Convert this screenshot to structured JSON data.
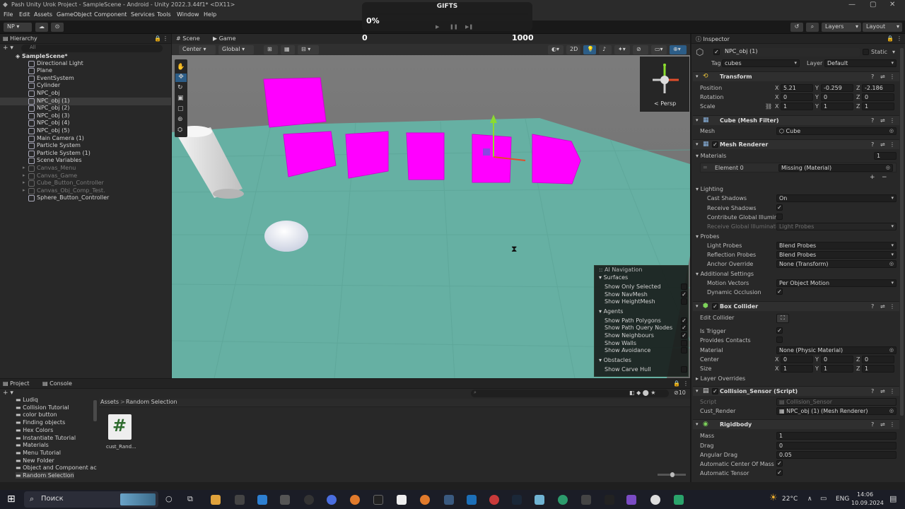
{
  "window": {
    "title": "Pash Unity Urok Project - SampleScene - Android - Unity 2022.3.44f1* <DX11>",
    "menu": [
      "File",
      "Edit",
      "Assets",
      "GameObject",
      "Component",
      "Services",
      "Tools",
      "Window",
      "Help"
    ]
  },
  "toolbar": {
    "account": "NP",
    "layers": "Layers",
    "layout": "Layout"
  },
  "gifts": {
    "label": "GIFTS",
    "percent": "0%",
    "left_num": "0",
    "right_num": "1000",
    "progress_fraction": 0.0
  },
  "hierarchy": {
    "tab": "Hierarchy",
    "search_placeholder": "All",
    "scene": "SampleScene*",
    "items": [
      {
        "label": "Directional Light",
        "gray": false
      },
      {
        "label": "Plane",
        "gray": false
      },
      {
        "label": "EventSystem",
        "gray": false
      },
      {
        "label": "Cylinder",
        "gray": false
      },
      {
        "label": "NPC_obj",
        "gray": false
      },
      {
        "label": "NPC_obj (1)",
        "gray": false,
        "selected": true
      },
      {
        "label": "NPC_obj (2)",
        "gray": false
      },
      {
        "label": "NPC_obj (3)",
        "gray": false
      },
      {
        "label": "NPC_obj (4)",
        "gray": false
      },
      {
        "label": "NPC_obj (5)",
        "gray": false
      },
      {
        "label": "Main Camera (1)",
        "gray": false
      },
      {
        "label": "Particle System",
        "gray": false
      },
      {
        "label": "Particle System (1)",
        "gray": false
      },
      {
        "label": "Scene Variables",
        "gray": false
      },
      {
        "label": "Canvas_Menu",
        "gray": true
      },
      {
        "label": "Canvas_Game",
        "gray": true
      },
      {
        "label": "Cube_Button_Controller",
        "gray": true
      },
      {
        "label": "Canvas_Obj_Comp_Test.",
        "gray": true
      },
      {
        "label": "Sphere_Button_Controller",
        "gray": false
      }
    ]
  },
  "scene_view": {
    "tabs": [
      "Scene",
      "Game"
    ],
    "pivot": "Center",
    "space": "Global",
    "mode_2d": "2D",
    "persp": "Persp"
  },
  "ai_navigation": {
    "title": "AI Navigation",
    "sections": [
      {
        "name": "Surfaces",
        "items": [
          {
            "label": "Show Only Selected",
            "checked": false
          },
          {
            "label": "Show NavMesh",
            "checked": true
          },
          {
            "label": "Show HeightMesh",
            "checked": false
          }
        ]
      },
      {
        "name": "Agents",
        "items": [
          {
            "label": "Show Path Polygons",
            "checked": true
          },
          {
            "label": "Show Path Query Nodes",
            "checked": true
          },
          {
            "label": "Show Neighbours",
            "checked": true
          },
          {
            "label": "Show Walls",
            "checked": false
          },
          {
            "label": "Show Avoidance",
            "checked": false
          }
        ]
      },
      {
        "name": "Obstacles",
        "items": [
          {
            "label": "Show Carve Hull",
            "checked": false
          }
        ]
      }
    ]
  },
  "project": {
    "tabs": [
      "Project",
      "Console"
    ],
    "folders": [
      "Ludiq",
      "Collision Tutorial",
      "color button",
      "Finding objects",
      "Hex Colors",
      "Instantiate Tutorial",
      "Materials",
      "Menu Tutorial",
      "New Folder",
      "Object and Component ac",
      "Random Selection"
    ],
    "breadcrumb": [
      "Assets",
      "Random Selection"
    ],
    "hidden_count": "10",
    "asset_label": "cust_Rand..."
  },
  "inspector": {
    "tab": "Inspector",
    "object_name": "NPC_obj (1)",
    "static_label": "Static",
    "tag_label": "Tag",
    "tag_value": "cubes",
    "layer_label": "Layer",
    "layer_value": "Default",
    "transform": {
      "title": "Transform",
      "position_label": "Position",
      "position": [
        "5.21",
        "-0.259",
        "-2.186"
      ],
      "rotation_label": "Rotation",
      "rotation": [
        "0",
        "0",
        "0"
      ],
      "scale_label": "Scale",
      "scale": [
        "1",
        "1",
        "1"
      ]
    },
    "mesh_filter": {
      "title": "Cube (Mesh Filter)",
      "mesh_label": "Mesh",
      "mesh_value": "Cube"
    },
    "mesh_renderer": {
      "title": "Mesh Renderer",
      "materials_label": "Materials",
      "materials_count": "1",
      "element_label": "Element 0",
      "element_value": "Missing (Material)",
      "lighting": "Lighting",
      "cast_shadows_label": "Cast Shadows",
      "cast_shadows": "On",
      "receive_shadows_label": "Receive Shadows",
      "contribute_gi_label": "Contribute Global Illumina",
      "receive_gi_label": "Receive Global Illuminatio",
      "receive_gi": "Light Probes",
      "probes": "Probes",
      "light_probes_label": "Light Probes",
      "light_probes": "Blend Probes",
      "reflection_probes_label": "Reflection Probes",
      "reflection_probes": "Blend Probes",
      "anchor_label": "Anchor Override",
      "anchor": "None (Transform)",
      "additional": "Additional Settings",
      "motion_vectors_label": "Motion Vectors",
      "motion_vectors": "Per Object Motion",
      "dynamic_occlusion_label": "Dynamic Occlusion"
    },
    "box_collider": {
      "title": "Box Collider",
      "edit_collider_label": "Edit Collider",
      "is_trigger_label": "Is Trigger",
      "provides_contacts_label": "Provides Contacts",
      "material_label": "Material",
      "material": "None (Physic Material)",
      "center_label": "Center",
      "center": [
        "0",
        "0",
        "0"
      ],
      "size_label": "Size",
      "size": [
        "1",
        "1",
        "1"
      ],
      "layer_overrides": "Layer Overrides"
    },
    "collision_sensor": {
      "title": "Collision_Sensor (Script)",
      "script_label": "Script",
      "script_value": "Collision_Sensor",
      "cust_render_label": "Cust_Render",
      "cust_render_value": "NPC_obj (1) (Mesh Renderer)"
    },
    "rigidbody": {
      "title": "Rigidbody",
      "mass_label": "Mass",
      "mass": "1",
      "drag_label": "Drag",
      "drag": "0",
      "angular_drag_label": "Angular Drag",
      "angular_drag": "0.05",
      "auto_com_label": "Automatic Center Of Mass",
      "auto_tensor_label": "Automatic Tensor"
    }
  },
  "taskbar": {
    "search": "Поиск",
    "weather": "22°C",
    "lang": "ENG",
    "time": "14:06",
    "date": "10.09.2024"
  }
}
